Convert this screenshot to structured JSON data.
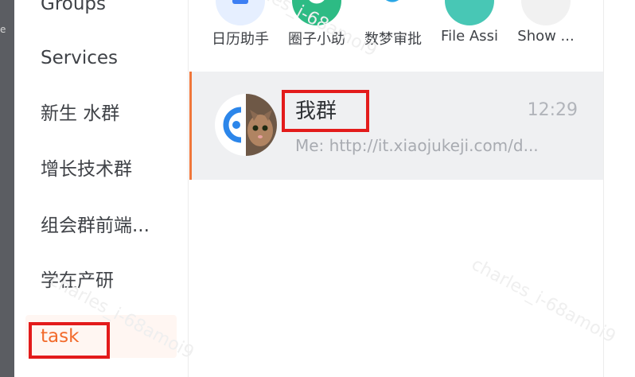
{
  "sidebar": {
    "items": [
      {
        "label": "Groups"
      },
      {
        "label": "Services"
      },
      {
        "label": "新生 水群"
      },
      {
        "label": "增长技术群"
      },
      {
        "label": "组会群前端..."
      },
      {
        "label": "学在产研"
      },
      {
        "label": "task",
        "active": true
      }
    ]
  },
  "apps": [
    {
      "label": "日历助手",
      "icon": "calendar-icon",
      "color": "#e6efff"
    },
    {
      "label": "圈子小助",
      "icon": "circle-icon",
      "color": "#2dbb84"
    },
    {
      "label": "数梦审批",
      "icon": "approval-icon",
      "color": "#2aa7e6"
    },
    {
      "label": "File Assi",
      "icon": "file-assistant-icon",
      "color": "#48c7b5"
    },
    {
      "label": "Show ...",
      "icon": "more-icon",
      "color": "#f1f1f1"
    }
  ],
  "chat": {
    "name": "我群",
    "time": "12:29",
    "preview": "Me: http://it.xiaojukeji.com/d..."
  },
  "watermark": "charles_i-68amoi9",
  "colors": {
    "accent": "#f26a2b",
    "highlight": "#e31b1b",
    "selected_bg": "#eff0f2",
    "rail": "#5b5d62"
  }
}
